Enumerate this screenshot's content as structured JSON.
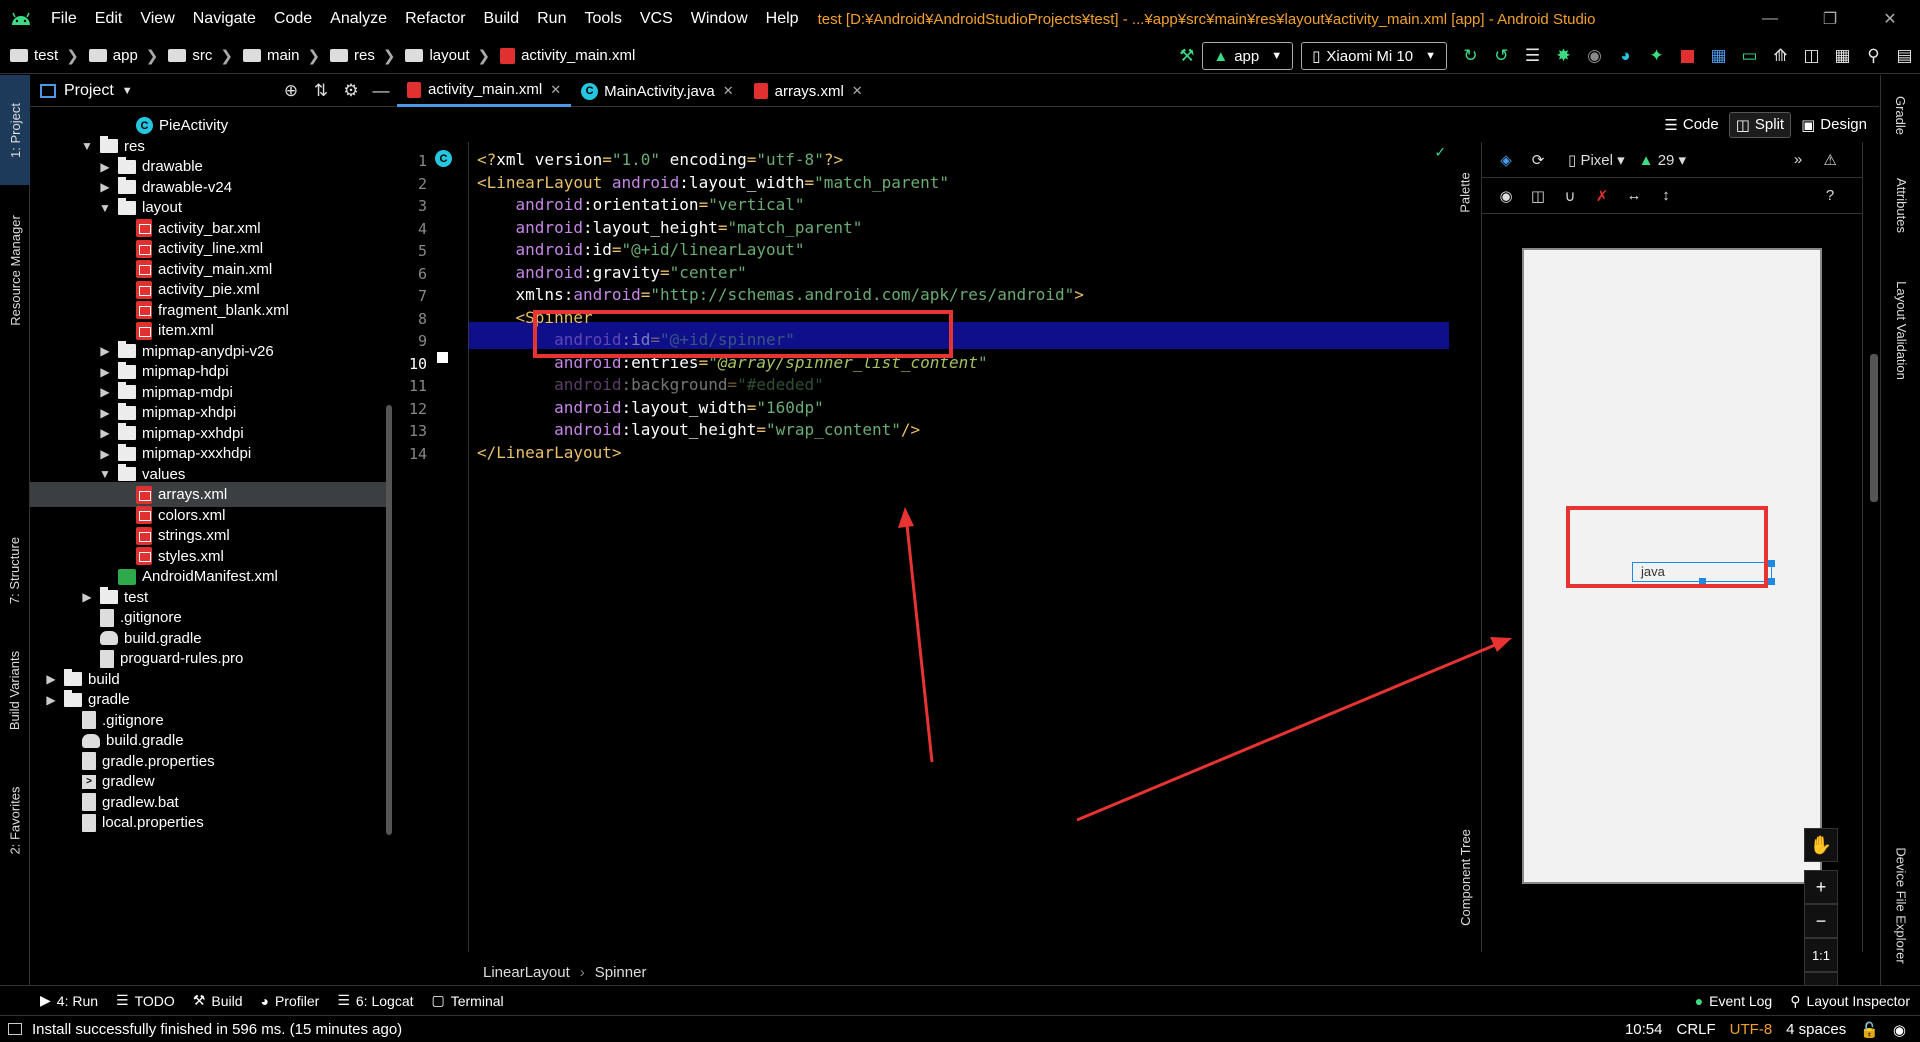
{
  "menubar": {
    "items": [
      "File",
      "Edit",
      "View",
      "Navigate",
      "Code",
      "Analyze",
      "Refactor",
      "Build",
      "Run",
      "Tools",
      "VCS",
      "Window",
      "Help"
    ],
    "title": "test [D:¥Android¥AndroidStudioProjects¥test] - ...¥app¥src¥main¥res¥layout¥activity_main.xml [app] - Android Studio"
  },
  "navbar": {
    "breadcrumbs": [
      "test",
      "app",
      "src",
      "main",
      "res",
      "layout"
    ],
    "current_file": "activity_main.xml",
    "run_config": "app",
    "device": "Xiaomi Mi 10"
  },
  "sidebar_left": {
    "project_tab": "1: Project",
    "resource_tab": "Resource Manager",
    "structure_tab": "7: Structure",
    "variants_tab": "Build Variants",
    "favorites_tab": "2: Favorites"
  },
  "project": {
    "header": "Project",
    "tree": [
      {
        "label": "PieActivity",
        "icon": "class",
        "depth": 5,
        "expand": ""
      },
      {
        "label": "res",
        "icon": "folder",
        "depth": 3,
        "expand": "open"
      },
      {
        "label": "drawable",
        "icon": "folder",
        "depth": 4,
        "expand": "closed"
      },
      {
        "label": "drawable-v24",
        "icon": "folder",
        "depth": 4,
        "expand": "closed"
      },
      {
        "label": "layout",
        "icon": "folder",
        "depth": 4,
        "expand": "open"
      },
      {
        "label": "activity_bar.xml",
        "icon": "xml",
        "depth": 5,
        "expand": ""
      },
      {
        "label": "activity_line.xml",
        "icon": "xml",
        "depth": 5,
        "expand": ""
      },
      {
        "label": "activity_main.xml",
        "icon": "xml",
        "depth": 5,
        "expand": ""
      },
      {
        "label": "activity_pie.xml",
        "icon": "xml",
        "depth": 5,
        "expand": ""
      },
      {
        "label": "fragment_blank.xml",
        "icon": "xml",
        "depth": 5,
        "expand": ""
      },
      {
        "label": "item.xml",
        "icon": "xml",
        "depth": 5,
        "expand": ""
      },
      {
        "label": "mipmap-anydpi-v26",
        "icon": "folder",
        "depth": 4,
        "expand": "closed"
      },
      {
        "label": "mipmap-hdpi",
        "icon": "folder",
        "depth": 4,
        "expand": "closed"
      },
      {
        "label": "mipmap-mdpi",
        "icon": "folder",
        "depth": 4,
        "expand": "closed"
      },
      {
        "label": "mipmap-xhdpi",
        "icon": "folder",
        "depth": 4,
        "expand": "closed"
      },
      {
        "label": "mipmap-xxhdpi",
        "icon": "folder",
        "depth": 4,
        "expand": "closed"
      },
      {
        "label": "mipmap-xxxhdpi",
        "icon": "folder",
        "depth": 4,
        "expand": "closed"
      },
      {
        "label": "values",
        "icon": "folder",
        "depth": 4,
        "expand": "open"
      },
      {
        "label": "arrays.xml",
        "icon": "xml",
        "depth": 5,
        "expand": "",
        "selected": true
      },
      {
        "label": "colors.xml",
        "icon": "xml",
        "depth": 5,
        "expand": ""
      },
      {
        "label": "strings.xml",
        "icon": "xml",
        "depth": 5,
        "expand": ""
      },
      {
        "label": "styles.xml",
        "icon": "xml",
        "depth": 5,
        "expand": ""
      },
      {
        "label": "AndroidManifest.xml",
        "icon": "manifest",
        "depth": 4,
        "expand": ""
      },
      {
        "label": "test",
        "icon": "folder",
        "depth": 3,
        "expand": "closed"
      },
      {
        "label": ".gitignore",
        "icon": "file",
        "depth": 3,
        "expand": ""
      },
      {
        "label": "build.gradle",
        "icon": "gradle",
        "depth": 3,
        "expand": ""
      },
      {
        "label": "proguard-rules.pro",
        "icon": "file",
        "depth": 3,
        "expand": ""
      },
      {
        "label": "build",
        "icon": "folder",
        "depth": 1,
        "expand": "closed"
      },
      {
        "label": "gradle",
        "icon": "folder",
        "depth": 1,
        "expand": "closed"
      },
      {
        "label": ".gitignore",
        "icon": "file",
        "depth": 2,
        "expand": ""
      },
      {
        "label": "build.gradle",
        "icon": "gradle",
        "depth": 2,
        "expand": ""
      },
      {
        "label": "gradle.properties",
        "icon": "file",
        "depth": 2,
        "expand": ""
      },
      {
        "label": "gradlew",
        "icon": "term",
        "depth": 2,
        "expand": ""
      },
      {
        "label": "gradlew.bat",
        "icon": "file",
        "depth": 2,
        "expand": ""
      },
      {
        "label": "local.properties",
        "icon": "file",
        "depth": 2,
        "expand": ""
      }
    ]
  },
  "editor_tabs": [
    {
      "label": "activity_main.xml",
      "active": true,
      "icon": "xml"
    },
    {
      "label": "MainActivity.java",
      "active": false,
      "icon": "class"
    },
    {
      "label": "arrays.xml",
      "active": false,
      "icon": "xml"
    }
  ],
  "view_modes": {
    "code": "Code",
    "split": "Split",
    "design": "Design"
  },
  "code": {
    "current_line": 10,
    "lines": [
      {
        "n": "1",
        "html": "<span class='t-punc'>&lt;?</span><span class='t-attr'>xml version</span><span class='t-punc'>=</span><span class='t-val'>\"1.0\"</span><span class='t-attr'> encoding</span><span class='t-punc'>=</span><span class='t-val'>\"utf-8\"</span><span class='t-punc'>?&gt;</span>"
      },
      {
        "n": "2",
        "html": "<span class='t-tag'>&lt;LinearLayout </span><span class='t-ns'>android</span><span class='t-attr'>:layout_width</span><span class='t-punc'>=</span><span class='t-val'>\"match_parent\"</span>"
      },
      {
        "n": "3",
        "html": "    <span class='t-ns'>android</span><span class='t-attr'>:orientation</span><span class='t-punc'>=</span><span class='t-val'>\"vertical\"</span>"
      },
      {
        "n": "4",
        "html": "    <span class='t-ns'>android</span><span class='t-attr'>:layout_height</span><span class='t-punc'>=</span><span class='t-val'>\"match_parent\"</span>"
      },
      {
        "n": "5",
        "html": "    <span class='t-ns'>android</span><span class='t-attr'>:id</span><span class='t-punc'>=</span><span class='t-val'>\"@+id/linearLayout\"</span>"
      },
      {
        "n": "6",
        "html": "    <span class='t-ns'>android</span><span class='t-attr'>:gravity</span><span class='t-punc'>=</span><span class='t-val'>\"center\"</span>"
      },
      {
        "n": "7",
        "html": "    <span class='t-attr'>xmlns:</span><span class='t-ns'>android</span><span class='t-punc'>=</span><span class='t-val'>\"http://schemas.android.com/apk/res/android\"</span><span class='t-tag'>&gt;</span>"
      },
      {
        "n": "8",
        "html": "    <span class='t-tag'>&lt;Spinner</span>"
      },
      {
        "n": "9",
        "html": "        <span class='t-ns'>android</span><span class='t-attr'>:id</span><span class='t-punc'>=</span><span class='t-val'>\"@+id/spinner\"</span>"
      },
      {
        "n": "10",
        "html": "        <span class='t-ns'>android</span><span class='t-attr'>:entries</span><span class='t-punc'>=</span><span class='t-val'>\"</span><span class='t-ref'>@array/spinner_list_content</span><span class='t-val'>\"</span>"
      },
      {
        "n": "11",
        "html": "        <span class='t-ns'>android</span><span class='t-attr'>:background</span><span class='t-punc'>=</span><span class='t-val'>\"#ededed\"</span>"
      },
      {
        "n": "12",
        "html": "        <span class='t-ns'>android</span><span class='t-attr'>:layout_width</span><span class='t-punc'>=</span><span class='t-val'>\"160dp\"</span>"
      },
      {
        "n": "13",
        "html": "        <span class='t-ns'>android</span><span class='t-attr'>:layout_height</span><span class='t-punc'>=</span><span class='t-val'>\"wrap_content\"</span><span class='t-tag'>/&gt;</span>"
      },
      {
        "n": "14",
        "html": "<span class='t-tag'>&lt;/LinearLayout&gt;</span>"
      }
    ]
  },
  "editor_breadcrumb": [
    "LinearLayout",
    "Spinner"
  ],
  "design": {
    "device": "Pixel",
    "api": "29",
    "spinner_text": "java",
    "zoom_label": "1:1",
    "palette_tab": "Palette",
    "component_tree_tab": "Component Tree"
  },
  "sidebar_right": {
    "gradle": "Gradle",
    "attributes": "Attributes",
    "layout_validation": "Layout Validation",
    "device_explorer": "Device File Explorer"
  },
  "toolwindows": {
    "run": "4: Run",
    "todo": "TODO",
    "build": "Build",
    "profiler": "Profiler",
    "logcat": "6: Logcat",
    "terminal": "Terminal",
    "event_log": "Event Log",
    "layout_inspector": "Layout Inspector"
  },
  "status": {
    "message": "Install successfully finished in 596 ms. (15 minutes ago)",
    "position": "10:54",
    "line_sep": "CRLF",
    "encoding": "UTF-8",
    "indent": "4 spaces"
  },
  "colors": {
    "accent_blue": "#4a9ae8",
    "annotation_red": "#e83333",
    "current_line": "#0f0f8c",
    "string_green": "#6aab73",
    "tag_yellow": "#e8bf6a",
    "ns_purple": "#c586e6"
  }
}
